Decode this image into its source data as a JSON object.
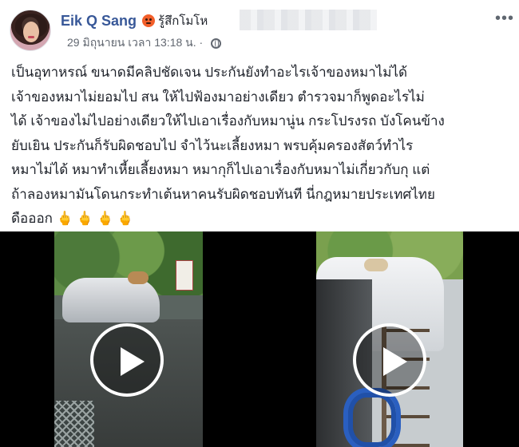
{
  "post": {
    "author": "Eik Q Sang",
    "feeling_text": "รู้สึกโมโห",
    "timestamp": "29 มิถุนายน เวลา 13:18 น. ·",
    "privacy_icon": "globe-icon",
    "more_icon": "more-options-icon",
    "more_glyph": "•••",
    "body_lines": [
      "เป็นอุทาหรณ์ ขนาดมีคลิปชัดเจน ประกันยังทำอะไรเจ้าของหมาไม่ได้",
      "เจ้าของหมาไม่ยอมไป สน ให้ไปฟ้องมาอย่างเดียว ตำรวจมาก็พูดอะไรไม่",
      "ได้ เจ้าของไม่ไปอย่างเดียวให้ไปเอาเรื่องกับหมานู่น กระโปรงรถ บังโคนข้าง",
      "ยับเยิน ประกันก็รับผิดชอบไป จำไว้นะเลี้ยงหมา พรบคุ้มครองสัตว์ทำไร",
      "หมาไม่ได้ หมาทำเหี้ยเลี้ยงหมา หมากุก็ไปเอาเรื่องกับหมาไม่เกี่ยวกับกุ แต่",
      "ถ้าลองหมามันโดนกระทำเต้นหาคนรับผิดชอบทันที นี่กฎหมายประเทศไทย"
    ],
    "last_line": "ดือออก",
    "emoji": "🖕🖕🖕🖕"
  },
  "media": {
    "videos": [
      {
        "id": "left",
        "play_icon": "play-icon"
      },
      {
        "id": "right",
        "play_icon": "play-icon"
      }
    ]
  },
  "colors": {
    "author": "#385898",
    "meta": "#616770",
    "text": "#1d2129",
    "feeling_emoji": "#f25f2a"
  }
}
